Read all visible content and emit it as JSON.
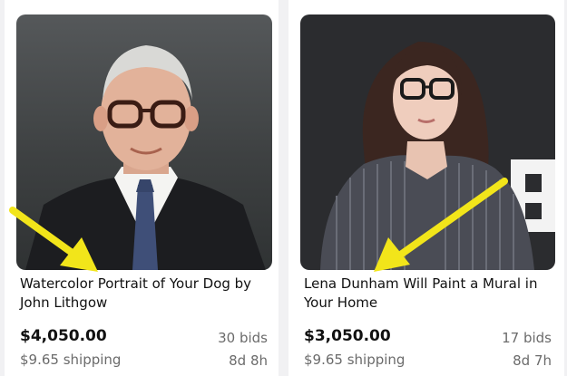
{
  "listings": [
    {
      "title": "Watercolor Portrait of Your Dog by John Lithgow",
      "price": "$4,050.00",
      "shipping": "$9.65 shipping",
      "bids": "30 bids",
      "time_left": "8d 8h"
    },
    {
      "title": "Lena Dunham Will Paint a Mural in Your Home",
      "price": "$3,050.00",
      "shipping": "$9.65 shipping",
      "bids": "17 bids",
      "time_left": "8d 7h"
    }
  ],
  "colors": {
    "annotation_arrow": "#f2e51a",
    "text_primary": "#111111",
    "text_secondary": "#6b6b6b"
  }
}
